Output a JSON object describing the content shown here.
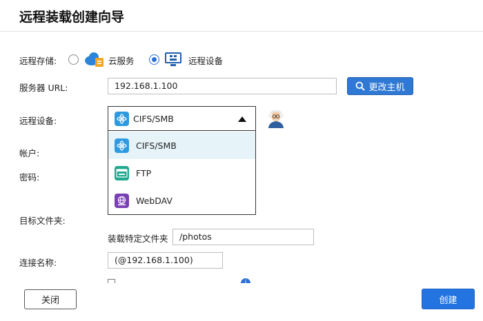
{
  "title": "远程装载创建向导",
  "storage": {
    "label": "远程存储:",
    "options": [
      {
        "label": "云服务",
        "icon": "cloud-icon",
        "checked": false
      },
      {
        "label": "远程设备",
        "icon": "remote-device-icon",
        "checked": true
      }
    ]
  },
  "server": {
    "label": "服务器 URL:",
    "value": "192.168.1.100",
    "change_button": "更改主机"
  },
  "device": {
    "label": "远程设备:",
    "selected": "CIFS/SMB",
    "options": [
      {
        "label": "CIFS/SMB",
        "icon": "cifs-smb-icon",
        "color": "#2e9ae0"
      },
      {
        "label": "FTP",
        "icon": "ftp-icon",
        "color": "#21a88e"
      },
      {
        "label": "WebDAV",
        "icon": "webdav-icon",
        "color": "#7a3fb5"
      }
    ]
  },
  "account": {
    "label": "帐户:"
  },
  "password": {
    "label": "密码:"
  },
  "target_folder": {
    "label": "目标文件夹:",
    "sub_label": "装载特定文件夹",
    "value": "/photos"
  },
  "connection_name": {
    "label": "连接名称:",
    "value": "(@192.168.1.100)"
  },
  "buttons": {
    "close": "关闭",
    "create": "创建"
  },
  "colors": {
    "accent": "#2374e0",
    "dropdown_selected_bg": "#e6f4fa"
  }
}
